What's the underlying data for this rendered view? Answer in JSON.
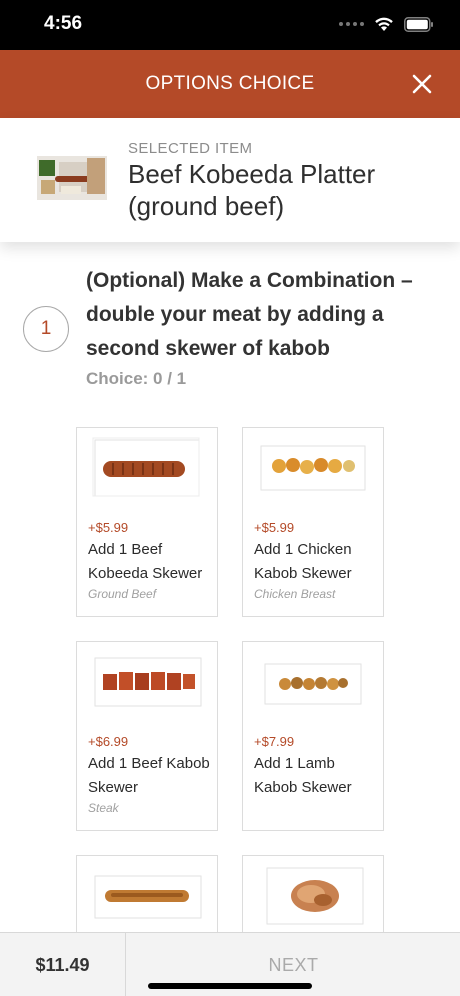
{
  "status_bar": {
    "time": "4:56",
    "icons": [
      "signal-icon",
      "wifi-icon",
      "battery-icon"
    ]
  },
  "header": {
    "title": "OPTIONS CHOICE",
    "close_icon": "close-icon"
  },
  "selected_item": {
    "eyebrow": "SELECTED ITEM",
    "name": "Beef Kobeeda Platter (ground beef)"
  },
  "group": {
    "step": "1",
    "title": "(Optional) Make a Combination – double your meat by adding a second skewer of kabob",
    "choice": "Choice: 0 / 1",
    "options": [
      {
        "price": "+$5.99",
        "name": "Add 1 Beef Kobeeda Skewer",
        "sub": "Ground Beef"
      },
      {
        "price": "+$5.99",
        "name": "Add 1 Chicken Kabob Skewer",
        "sub": "Chicken Breast"
      },
      {
        "price": "+$6.99",
        "name": "Add 1 Beef Kabob Skewer",
        "sub": "Steak"
      },
      {
        "price": "+$7.99",
        "name": "Add 1 Lamb Kabob Skewer",
        "sub": ""
      },
      {
        "price": "",
        "name": "",
        "sub": ""
      },
      {
        "price": "",
        "name": "",
        "sub": ""
      }
    ]
  },
  "footer": {
    "total": "$11.49",
    "next_label": "NEXT"
  },
  "colors": {
    "accent": "#b44a28",
    "status_bar": "#000000",
    "muted_text": "#9a9a9a"
  }
}
